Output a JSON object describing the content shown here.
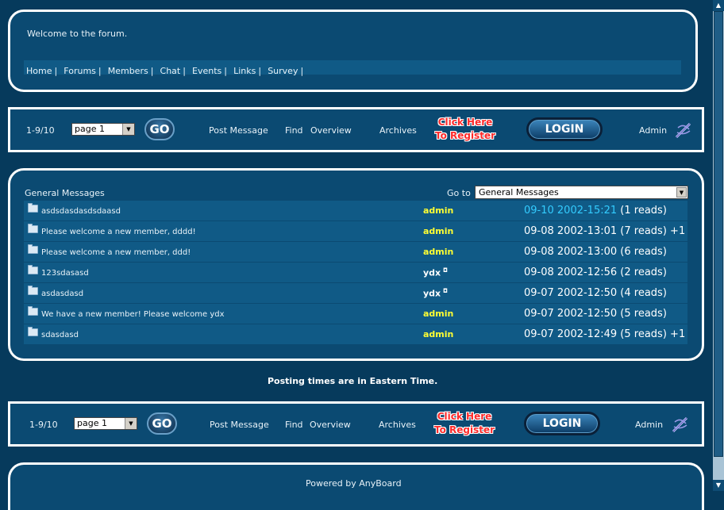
{
  "header": {
    "welcome": "Welcome to the forum.",
    "nav": [
      {
        "label": "Home"
      },
      {
        "label": "Forums"
      },
      {
        "label": "Members"
      },
      {
        "label": "Chat"
      },
      {
        "label": "Events"
      },
      {
        "label": "Links"
      },
      {
        "label": "Survey"
      }
    ]
  },
  "toolbar": {
    "range": "1-9/10",
    "page_select": "page 1",
    "go_label": "GO",
    "post_message": "Post Message",
    "find": "Find",
    "overview": "Overview",
    "archives": "Archives",
    "register_line1": "Click Here",
    "register_line2": "To Register",
    "login_label": "LOGIN",
    "admin": "Admin"
  },
  "forum": {
    "title": "General Messages",
    "goto_label": "Go to",
    "goto_value": "General Messages",
    "messages": [
      {
        "subject": "asdsdasdasdsdaasd",
        "author": "admin",
        "date": "09-10 2002-15:21",
        "reads": "(1 reads)",
        "extra": ""
      },
      {
        "subject": "Please welcome a new member, dddd!",
        "author": "admin",
        "date": "09-08 2002-13:01",
        "reads": "(7 reads)",
        "extra": "+1"
      },
      {
        "subject": "Please welcome a new member, ddd!",
        "author": "admin",
        "date": "09-08 2002-13:00",
        "reads": "(6 reads)",
        "extra": ""
      },
      {
        "subject": "123sdasasd",
        "author": "ydx",
        "date": "09-08 2002-12:56",
        "reads": "(2 reads)",
        "extra": ""
      },
      {
        "subject": "asdasdasd",
        "author": "ydx",
        "date": "09-07 2002-12:50",
        "reads": "(4 reads)",
        "extra": ""
      },
      {
        "subject": "We have a new member! Please welcome ydx",
        "author": "admin",
        "date": "09-07 2002-12:50",
        "reads": "(5 reads)",
        "extra": ""
      },
      {
        "subject": "sdasdasd",
        "author": "admin",
        "date": "09-07 2002-12:49",
        "reads": "(5 reads)",
        "extra": "+1"
      }
    ]
  },
  "footer": {
    "posting_note": "Posting times are in Eastern Time.",
    "powered": "Powered by AnyBoard"
  },
  "colors": {
    "background": "#063a5c",
    "panel": "#0b4a72",
    "row": "#105a86",
    "admin_name": "#ffff33",
    "highlight_date": "#33ccff",
    "register_text": "#ff2a2a"
  }
}
